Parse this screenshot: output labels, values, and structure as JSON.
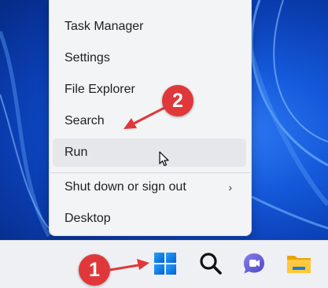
{
  "menu": {
    "items": [
      {
        "label": "Task Manager"
      },
      {
        "label": "Settings"
      },
      {
        "label": "File Explorer"
      },
      {
        "label": "Search"
      },
      {
        "label": "Run"
      },
      {
        "label": "Shut down or sign out"
      },
      {
        "label": "Desktop"
      }
    ],
    "hovered_item": "Run",
    "submenu_indicator": "›"
  },
  "annotations": {
    "step1": "1",
    "step2": "2",
    "badge_color": "#e0383a"
  },
  "taskbar": {
    "icons": [
      "windows-start-icon",
      "search-icon",
      "teams-chat-icon",
      "file-explorer-icon"
    ]
  }
}
